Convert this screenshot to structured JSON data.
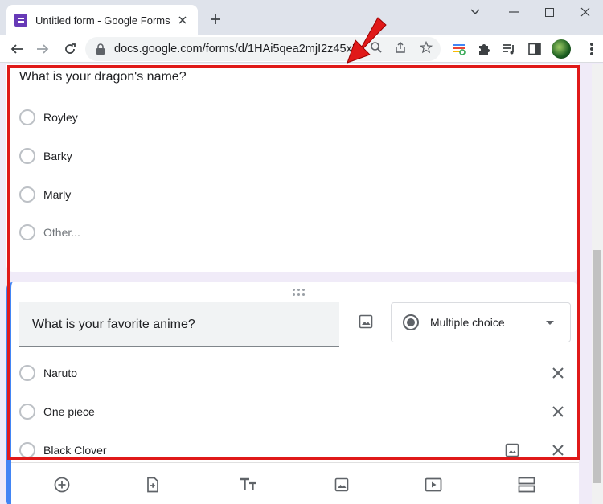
{
  "browser": {
    "tab_title": "Untitled form - Google Forms",
    "url": "docs.google.com/forms/d/1HAi5qea2mjI2z45xP",
    "icons": [
      "forms-favicon",
      "close-icon",
      "plus-icon",
      "minimize-icon",
      "maximize-icon",
      "window-close-icon",
      "back-arrow-icon",
      "forward-arrow-icon",
      "lock-icon",
      "search-icon",
      "share-icon",
      "star-icon",
      "extension-icon",
      "puzzle-icon",
      "media-icon",
      "sidepanel-icon",
      "avatar",
      "menu-icon"
    ]
  },
  "question1": {
    "title": "What is your dragon's name?",
    "options": [
      "Royley",
      "Barky",
      "Marly"
    ],
    "other_label": "Other..."
  },
  "question2": {
    "title": "What is your favorite anime?",
    "type_label": "Multiple choice",
    "options": [
      "Naruto",
      "One piece",
      "Black Clover"
    ]
  },
  "bottom_toolbar": [
    "add-question-icon",
    "import-questions-icon",
    "add-title-icon",
    "add-image-icon",
    "add-video-icon",
    "add-section-icon"
  ],
  "colors": {
    "forms_purple": "#673ab7",
    "page_background": "#f0ebf8",
    "active_accent": "#4285f4",
    "annotation_red": "#e01919"
  }
}
